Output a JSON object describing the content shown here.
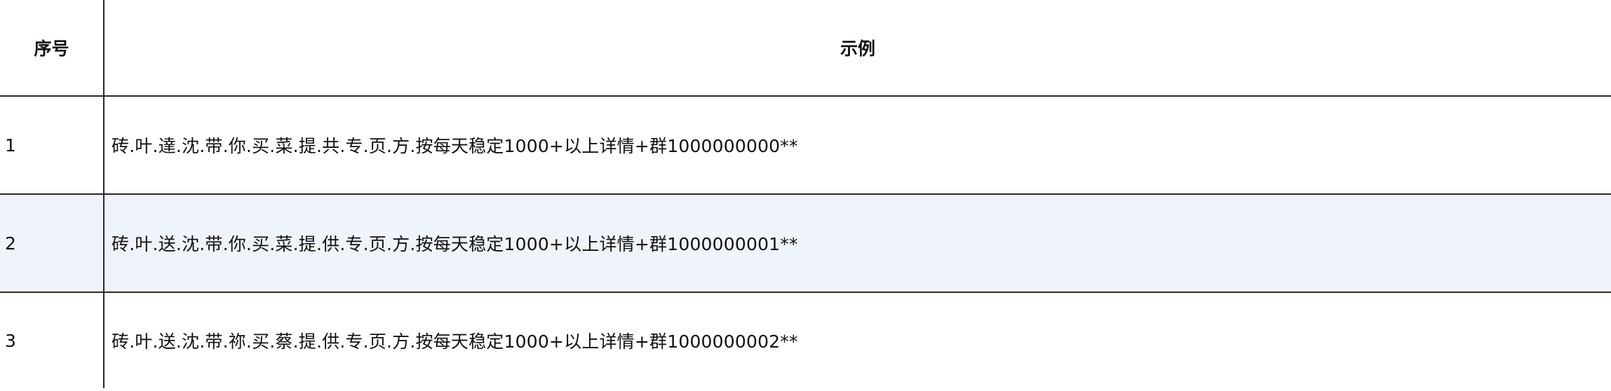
{
  "columns": {
    "index": "序号",
    "example": "示例"
  },
  "rows": [
    {
      "index": "1",
      "example": "砖.叶.達.沈.带.你.买.菜.提.共.专.页.方.按每天稳定1000+以上详情+群1000000000**"
    },
    {
      "index": "2",
      "example": "砖.叶.送.沈.带.你.买.菜.提.供.专.页.方.按每天稳定1000+以上详情+群1000000001**"
    },
    {
      "index": "3",
      "example": "砖.叶.送.沈.带.祢.买.蔡.提.供.专.页.方.按每天稳定1000+以上详情+群1000000002**"
    }
  ],
  "colors": {
    "selected_row_background": "#eff4fb",
    "grid_line": "#2b2b2b"
  }
}
